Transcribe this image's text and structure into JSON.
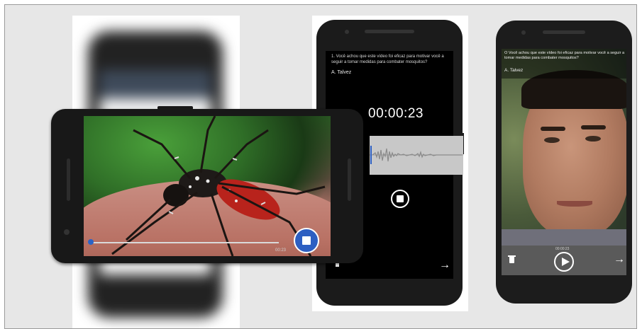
{
  "audio_screen": {
    "question": "1. Você achou que este vídeo foi eficaz para motivar você a seguir a tomar medidas para combater mosquitos?",
    "answer": "A. Talvez",
    "timer": "00:00:23",
    "next_arrow": "→"
  },
  "video_landscape": {
    "elapsed": "00:23"
  },
  "portrait_screen": {
    "question": "O Você achou que este vídeo foi eficaz para motivar você a seguir a tomar medidas para combater mosquitos?",
    "answer": "A. Talvez",
    "time": "00:00:23",
    "next_arrow": "→"
  },
  "colors": {
    "accent": "#2d5fc2",
    "panel_bg": "#e7e7e7"
  }
}
